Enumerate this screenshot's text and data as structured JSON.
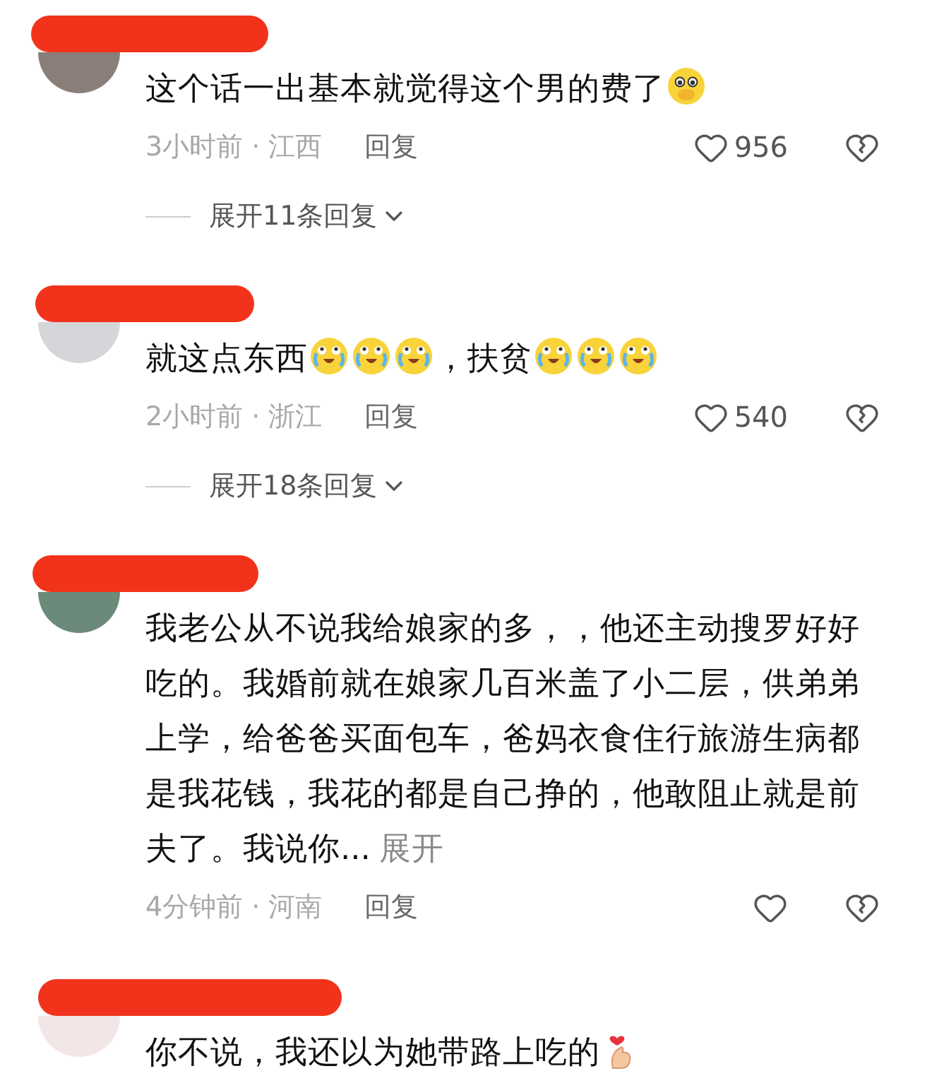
{
  "comments": [
    {
      "name_redacted": true,
      "body": [
        {
          "kind": "text",
          "text": "这个话一出基本就觉得这个男的费了"
        },
        {
          "kind": "pleading"
        }
      ],
      "time": "3小时前 · 江西",
      "reply": "回复",
      "likes": "956",
      "replies_link": "展开11条回复"
    },
    {
      "name_redacted": true,
      "body": [
        {
          "kind": "text",
          "text": "就这点东西"
        },
        {
          "kind": "crying"
        },
        {
          "kind": "crying"
        },
        {
          "kind": "crying"
        },
        {
          "kind": "text",
          "text": "，扶贫"
        },
        {
          "kind": "crying"
        },
        {
          "kind": "crying"
        },
        {
          "kind": "crying"
        }
      ],
      "time": "2小时前 · 浙江",
      "reply": "回复",
      "likes": "540",
      "replies_link": "展开18条回复"
    },
    {
      "name_redacted": true,
      "body": [
        {
          "kind": "text",
          "text": "我老公从不说我给娘家的多，，他还主动搜罗好好吃的。我婚前就在娘家几百米盖了小二层，供弟弟上学，给爸爸买面包车，爸妈衣食住行旅游生病都是我花钱，我花的都是自己挣的，他敢阻止就是前夫了。我说你..."
        }
      ],
      "expand_link": "展开",
      "time": "4分钟前 · 河南",
      "reply": "回复"
    },
    {
      "name_redacted": true,
      "body": [
        {
          "kind": "text",
          "text": "你不说，我还以为她带路上吃的"
        },
        {
          "kind": "fingerheart"
        }
      ]
    }
  ]
}
